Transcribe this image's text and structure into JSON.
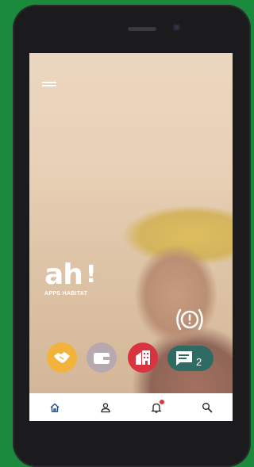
{
  "logo": {
    "mark": "ah",
    "tagline": "APPS HABITAT"
  },
  "icons": {
    "menu": "menu-icon",
    "alert": "alert-icon",
    "action_1": "handshake-icon",
    "action_2": "wallet-icon",
    "action_3": "building-icon",
    "chat": "chat-icon",
    "nav_home": "home-icon",
    "nav_profile": "profile-icon",
    "nav_notifications": "bell-icon",
    "nav_search": "search-icon"
  },
  "chat": {
    "count": "2"
  },
  "colors": {
    "device_background": "#1a8a3c",
    "handshake_button": "#f2b33a",
    "wallet_button": "#b8a8b0",
    "building_button": "#d9333f",
    "chat_button": "#2f6b63",
    "nav_active": "#1f4f8a",
    "notification_badge": "#e03a3a"
  }
}
